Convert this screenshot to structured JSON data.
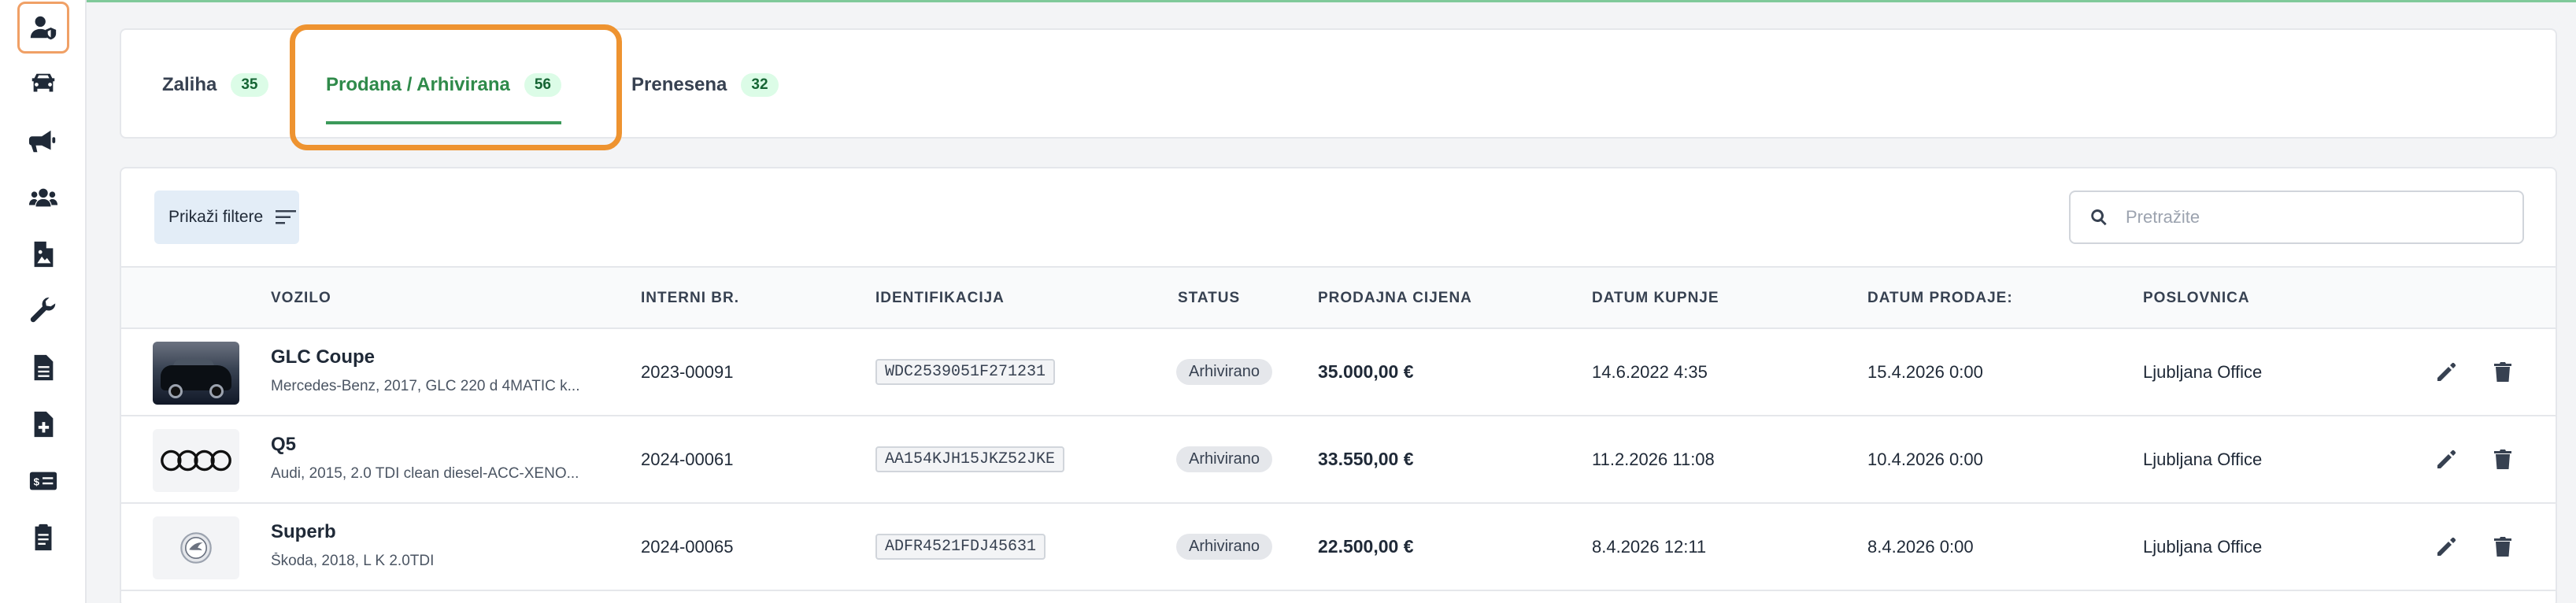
{
  "sidebar": {
    "items": [
      {
        "icon": "user-shield-icon",
        "active": true
      },
      {
        "icon": "car-icon"
      },
      {
        "icon": "megaphone-icon"
      },
      {
        "icon": "users-icon"
      },
      {
        "icon": "image-file-icon"
      },
      {
        "icon": "wrench-icon"
      },
      {
        "icon": "document-icon"
      },
      {
        "icon": "file-plus-icon"
      },
      {
        "icon": "money-card-icon"
      },
      {
        "icon": "report-icon"
      }
    ]
  },
  "tabs": [
    {
      "label": "Zaliha",
      "count": "35",
      "active": false
    },
    {
      "label": "Prodana / Arhivirana",
      "count": "56",
      "active": true
    },
    {
      "label": "Prenesena",
      "count": "32",
      "active": false
    }
  ],
  "toolbar": {
    "filter_label": "Prikaži filtere",
    "search_placeholder": "Pretražite"
  },
  "table": {
    "columns": [
      "VOZILO",
      "INTERNI BR.",
      "IDENTIFIKACIJA",
      "STATUS",
      "PRODAJNA CIJENA",
      "DATUM KUPNJE",
      "DATUM PRODAJE:",
      "POSLOVNICA"
    ],
    "rows": [
      {
        "name": "GLC Coupe",
        "desc": "Mercedes-Benz, 2017, GLC 220 d 4MATIC k...",
        "internal": "2023-00091",
        "vin": "WDC2539051F271231",
        "status": "Arhivirano",
        "price": "35.000,00 €",
        "bought": "14.6.2022 4:35",
        "sold": "15.4.2026 0:00",
        "branch": "Ljubljana Office",
        "thumb": "car-photo"
      },
      {
        "name": "Q5",
        "desc": "Audi, 2015, 2.0 TDI clean diesel-ACC-XENO...",
        "internal": "2024-00061",
        "vin": "AA154KJH15JKZ52JKE",
        "status": "Arhivirano",
        "price": "33.550,00 €",
        "bought": "11.2.2026 11:08",
        "sold": "10.4.2026 0:00",
        "branch": "Ljubljana Office",
        "thumb": "audi-logo"
      },
      {
        "name": "Superb",
        "desc": "Škoda, 2018, L K 2.0TDI",
        "internal": "2024-00065",
        "vin": "ADFR4521FDJ45631",
        "status": "Arhivirano",
        "price": "22.500,00 €",
        "bought": "8.4.2026 12:11",
        "sold": "8.4.2026 0:00",
        "branch": "Ljubljana Office",
        "thumb": "skoda-logo"
      }
    ]
  },
  "colors": {
    "accent_green": "#2f8a4a",
    "highlight_orange": "#ee9330",
    "badge_green_bg": "#dcfce7"
  }
}
